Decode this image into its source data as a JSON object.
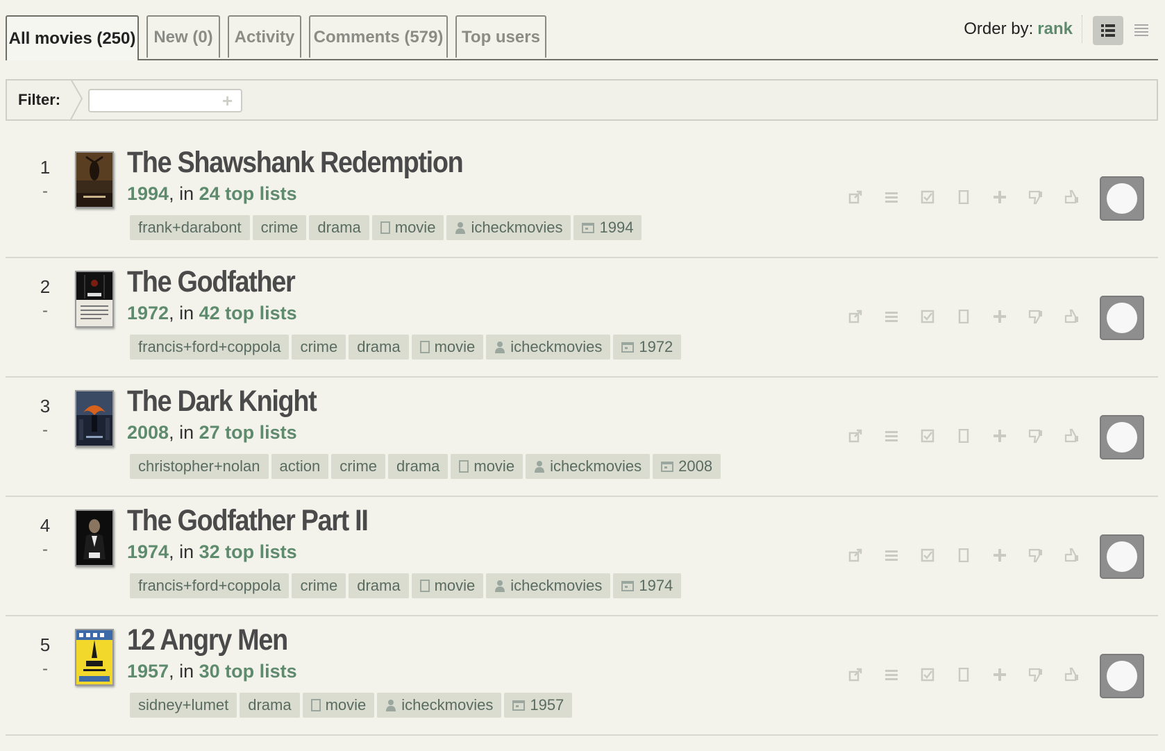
{
  "tabs": [
    {
      "label": "All movies (250)",
      "active": true
    },
    {
      "label": "New (0)",
      "active": false
    },
    {
      "label": "Activity",
      "active": false
    },
    {
      "label": "Comments (579)",
      "active": false
    },
    {
      "label": "Top users",
      "active": false
    }
  ],
  "order": {
    "label": "Order by:",
    "value": "rank"
  },
  "filter": {
    "label": "Filter:",
    "value": "",
    "placeholder": ""
  },
  "movies": [
    {
      "rank": "1",
      "change": "-",
      "title": "The Shawshank Redemption",
      "year": "1994",
      "in_text": ", in ",
      "lists": "24 top lists",
      "tags": [
        {
          "label": "frank+darabont",
          "icon": ""
        },
        {
          "label": "crime",
          "icon": ""
        },
        {
          "label": "drama",
          "icon": ""
        },
        {
          "label": "movie",
          "icon": "page"
        },
        {
          "label": "icheckmovies",
          "icon": "user"
        },
        {
          "label": "1994",
          "icon": "calendar"
        }
      ]
    },
    {
      "rank": "2",
      "change": "-",
      "title": "The Godfather",
      "year": "1972",
      "in_text": ", in ",
      "lists": "42 top lists",
      "tags": [
        {
          "label": "francis+ford+coppola",
          "icon": ""
        },
        {
          "label": "crime",
          "icon": ""
        },
        {
          "label": "drama",
          "icon": ""
        },
        {
          "label": "movie",
          "icon": "page"
        },
        {
          "label": "icheckmovies",
          "icon": "user"
        },
        {
          "label": "1972",
          "icon": "calendar"
        }
      ]
    },
    {
      "rank": "3",
      "change": "-",
      "title": "The Dark Knight",
      "year": "2008",
      "in_text": ", in ",
      "lists": "27 top lists",
      "tags": [
        {
          "label": "christopher+nolan",
          "icon": ""
        },
        {
          "label": "action",
          "icon": ""
        },
        {
          "label": "crime",
          "icon": ""
        },
        {
          "label": "drama",
          "icon": ""
        },
        {
          "label": "movie",
          "icon": "page"
        },
        {
          "label": "icheckmovies",
          "icon": "user"
        },
        {
          "label": "2008",
          "icon": "calendar"
        }
      ]
    },
    {
      "rank": "4",
      "change": "-",
      "title": "The Godfather Part II",
      "year": "1974",
      "in_text": ", in ",
      "lists": "32 top lists",
      "tags": [
        {
          "label": "francis+ford+coppola",
          "icon": ""
        },
        {
          "label": "crime",
          "icon": ""
        },
        {
          "label": "drama",
          "icon": ""
        },
        {
          "label": "movie",
          "icon": "page"
        },
        {
          "label": "icheckmovies",
          "icon": "user"
        },
        {
          "label": "1974",
          "icon": "calendar"
        }
      ]
    },
    {
      "rank": "5",
      "change": "-",
      "title": "12 Angry Men",
      "year": "1957",
      "in_text": ", in ",
      "lists": "30 top lists",
      "tags": [
        {
          "label": "sidney+lumet",
          "icon": ""
        },
        {
          "label": "drama",
          "icon": ""
        },
        {
          "label": "movie",
          "icon": "page"
        },
        {
          "label": "icheckmovies",
          "icon": "user"
        },
        {
          "label": "1957",
          "icon": "calendar"
        }
      ]
    }
  ],
  "row_actions": [
    "external-link-icon",
    "list-icon",
    "checkbox-icon",
    "page-icon",
    "plus-icon",
    "dislike-icon",
    "like-icon"
  ],
  "colors": {
    "accent": "#5e8a6e",
    "tag_bg": "#dadcd0",
    "background": "#f3f3ec",
    "check_button": "#8e8e8e"
  }
}
